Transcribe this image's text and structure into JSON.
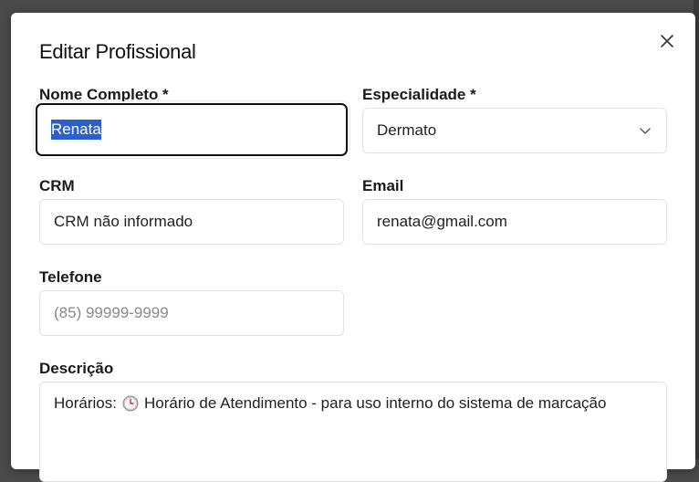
{
  "dialog": {
    "title": "Editar Profissional"
  },
  "fields": {
    "name": {
      "label": "Nome Completo *",
      "value": "Renata"
    },
    "specialty": {
      "label": "Especialidade *",
      "value": "Dermato"
    },
    "crm": {
      "label": "CRM",
      "value": "CRM não informado"
    },
    "email": {
      "label": "Email",
      "value": "renata@gmail.com"
    },
    "phone": {
      "label": "Telefone",
      "placeholder": "(85) 99999-9999"
    },
    "description": {
      "label": "Descrição",
      "prefix": "Horários:",
      "text": "Horário de Atendimento - para uso interno do sistema de marcação"
    }
  },
  "icons": {
    "close": "close-icon",
    "dropdown": "chevron-down-icon",
    "clock": "clock-icon"
  }
}
